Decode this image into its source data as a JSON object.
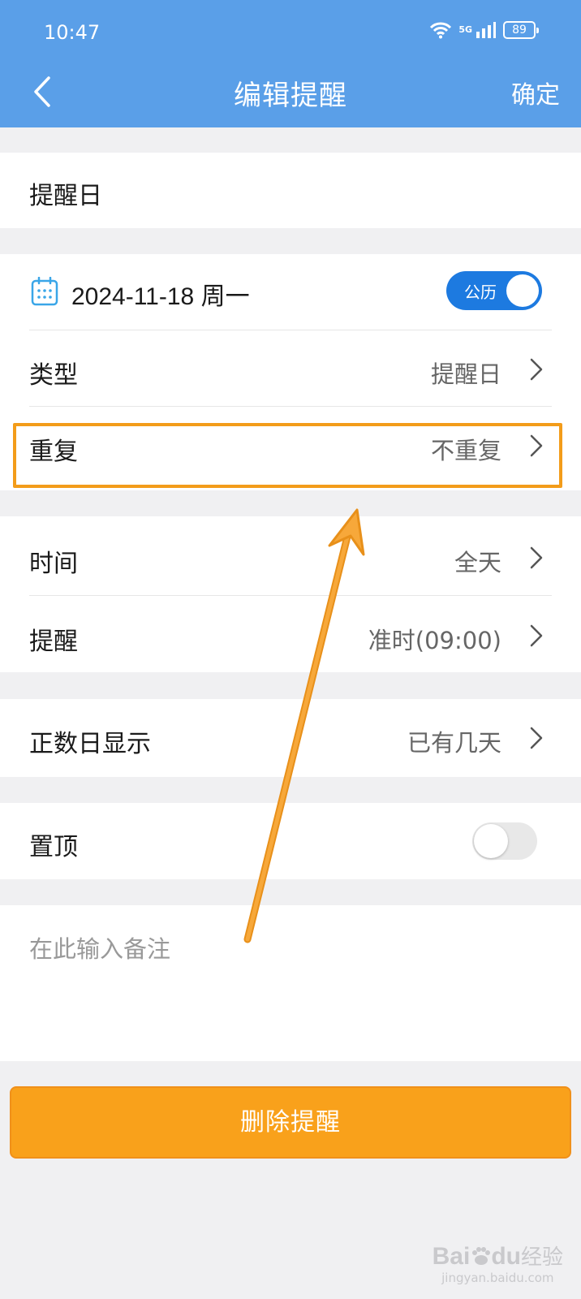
{
  "status_bar": {
    "time": "10:47",
    "network": "5G",
    "battery": "89"
  },
  "nav": {
    "title": "编辑提醒",
    "confirm": "确定"
  },
  "section_header": {
    "label": "提醒日"
  },
  "date_row": {
    "date": "2024-11-18 周一",
    "calendar_toggle_label": "公历",
    "calendar_toggle_on": true
  },
  "rows": {
    "type": {
      "label": "类型",
      "value": "提醒日"
    },
    "repeat": {
      "label": "重复",
      "value": "不重复"
    },
    "time": {
      "label": "时间",
      "value": "全天"
    },
    "reminder": {
      "label": "提醒",
      "value": "准时(09:00)"
    },
    "count_display": {
      "label": "正数日显示",
      "value": "已有几天"
    },
    "pin": {
      "label": "置顶",
      "toggle_on": false
    }
  },
  "note": {
    "placeholder": "在此输入备注"
  },
  "delete_button": {
    "label": "删除提醒"
  },
  "annotation": {
    "color": "#f39c1a"
  },
  "watermark": {
    "logo": "Bai",
    "paw": "du",
    "cn": "经验",
    "url": "jingyan.baidu.com"
  },
  "colors": {
    "header": "#5a9fe8",
    "toggle_on": "#1d7ae0",
    "delete": "#f9a11b"
  }
}
